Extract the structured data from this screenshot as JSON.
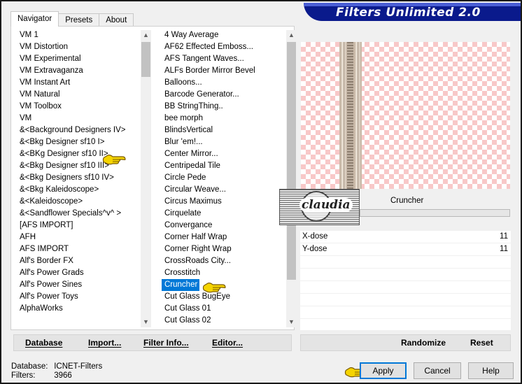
{
  "window": {
    "title": "Filters Unlimited 2.0"
  },
  "tabs": [
    {
      "label": "Navigator",
      "active": true
    },
    {
      "label": "Presets",
      "active": false
    },
    {
      "label": "About",
      "active": false
    }
  ],
  "categories": [
    "VM 1",
    "VM Distortion",
    "VM Experimental",
    "VM Extravaganza",
    "VM Instant Art",
    "VM Natural",
    "VM Toolbox",
    "VM",
    "&<Background Designers IV>",
    "&<Bkg Designer sf10 I>",
    "&<BKg Designer sf10 II>",
    "&<Bkg Designer sf10 III>",
    "&<Bkg Designers sf10 IV>",
    "&<Bkg Kaleidoscope>",
    "&<Kaleidoscope>",
    "&<Sandflower Specials^v^ >",
    "[AFS IMPORT]",
    "AFH",
    "AFS IMPORT",
    "Alf's Border FX",
    "Alf's Power Grads",
    "Alf's Power Sines",
    "Alf's Power Toys",
    "AlphaWorks"
  ],
  "filters": [
    "4 Way Average",
    "AF62 Effected Emboss...",
    "AFS Tangent Waves...",
    "ALFs Border Mirror Bevel",
    "Balloons...",
    "Barcode Generator...",
    "BB StringThing..",
    "bee morph",
    "BlindsVertical",
    "Blur 'em!...",
    "Center Mirror...",
    "Centripedal Tile",
    "Circle Pede",
    "Circular Weave...",
    "Circus Maximus",
    "Cirquelate",
    "Convergance",
    "Corner Half Wrap",
    "Corner Right Wrap",
    "CrossRoads City...",
    "Crosstitch",
    "Cruncher",
    "Cut Glass  BugEye",
    "Cut Glass 01",
    "Cut Glass 02"
  ],
  "selected_filter_index": 21,
  "left_toolbar": {
    "database": "Database",
    "import": "Import...",
    "filter_info": "Filter Info...",
    "editor": "Editor..."
  },
  "preview": {
    "filter_name": "Cruncher",
    "logo_text": "claudia"
  },
  "params": [
    {
      "label": "X-dose",
      "value": "11"
    },
    {
      "label": "Y-dose",
      "value": "11"
    }
  ],
  "right_toolbar": {
    "randomize": "Randomize",
    "reset": "Reset"
  },
  "status": {
    "database_label": "Database:",
    "database_value": "ICNET-Filters",
    "filters_label": "Filters:",
    "filters_value": "3966"
  },
  "buttons": {
    "apply": "Apply",
    "cancel": "Cancel",
    "help": "Help"
  },
  "colors": {
    "title_banner": "#0a1a8c",
    "selection": "#0078d7",
    "preview_checker": "#f8c8c8",
    "pointer_hand": "#f5d400"
  },
  "icons": [
    "pointing-hand-icon",
    "scroll-up-icon",
    "scroll-down-icon"
  ]
}
